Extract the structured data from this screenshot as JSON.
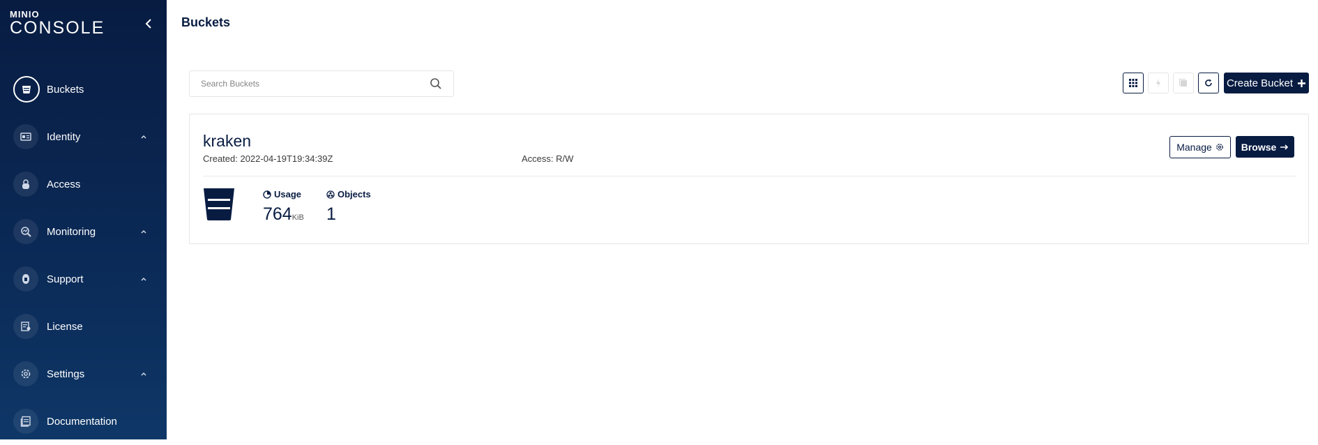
{
  "app": {
    "logo_top": "MINIO",
    "logo_bottom": "CONSOLE"
  },
  "sidebar": {
    "items": [
      {
        "label": "Buckets",
        "icon": "bucket-icon",
        "active": true,
        "has_caret": false
      },
      {
        "label": "Identity",
        "icon": "id-card-icon",
        "active": false,
        "has_caret": true
      },
      {
        "label": "Access",
        "icon": "lock-icon",
        "active": false,
        "has_caret": false
      },
      {
        "label": "Monitoring",
        "icon": "monitoring-icon",
        "active": false,
        "has_caret": true
      },
      {
        "label": "Support",
        "icon": "support-icon",
        "active": false,
        "has_caret": true
      },
      {
        "label": "License",
        "icon": "license-icon",
        "active": false,
        "has_caret": false
      },
      {
        "label": "Settings",
        "icon": "gear-icon",
        "active": false,
        "has_caret": true
      },
      {
        "label": "Documentation",
        "icon": "documentation-icon",
        "active": false,
        "has_caret": false
      }
    ]
  },
  "header": {
    "title": "Buckets"
  },
  "search": {
    "placeholder": "Search Buckets",
    "value": ""
  },
  "toolbar": {
    "create_label": "Create Bucket"
  },
  "bucket": {
    "name": "kraken",
    "created": "Created: 2022-04-19T19:34:39Z",
    "access": "Access: R/W",
    "manage_label": "Manage",
    "browse_label": "Browse",
    "usage_label": "Usage",
    "usage_value": "764",
    "usage_unit": "KiB",
    "objects_label": "Objects",
    "objects_value": "1"
  },
  "colors": {
    "primary": "#081c42",
    "sidebar_bottom": "#0e3767",
    "border": "#e5e5e5"
  }
}
